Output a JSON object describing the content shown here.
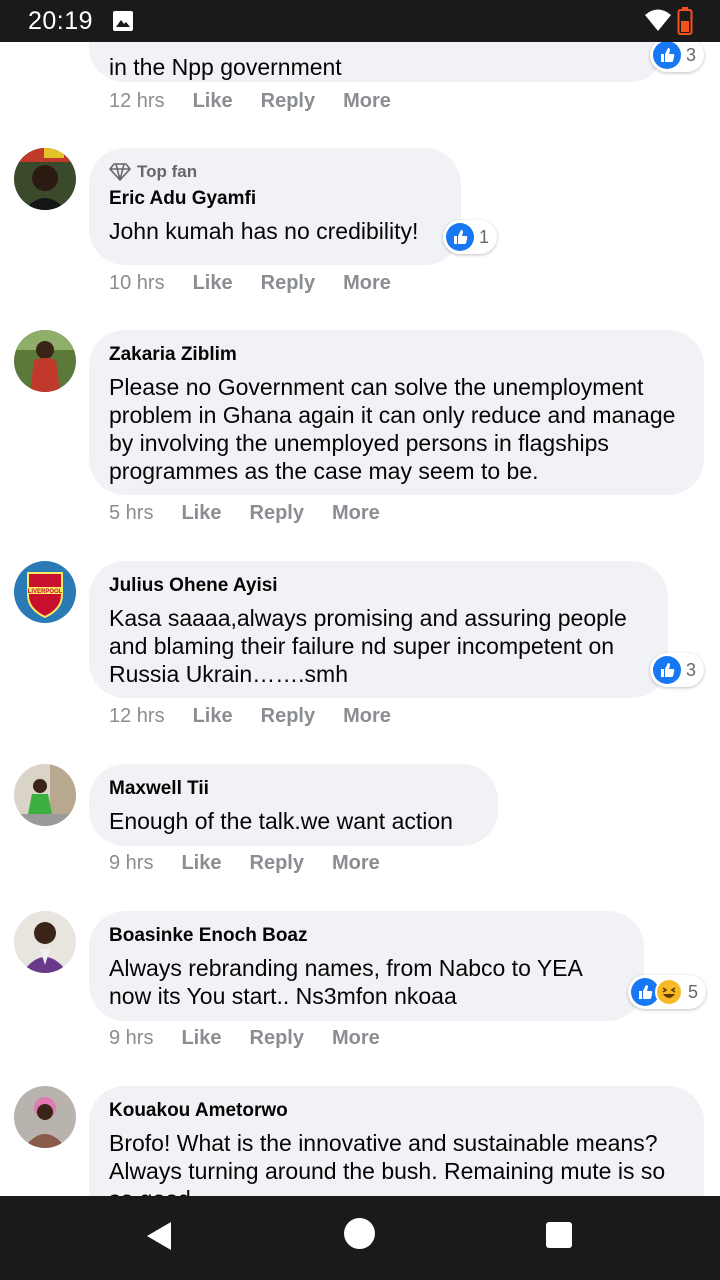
{
  "status_bar": {
    "time": "20:19"
  },
  "comments": [
    {
      "author": "",
      "text": "in the Npp government",
      "time": "12 hrs",
      "like": "Like",
      "reply": "Reply",
      "more": "More",
      "reaction_count": "3"
    },
    {
      "top_fan_label": "Top fan",
      "author": "Eric Adu Gyamfi",
      "text": "John kumah has no credibility!",
      "time": "10 hrs",
      "like": "Like",
      "reply": "Reply",
      "more": "More",
      "reaction_count": "1"
    },
    {
      "author": "Zakaria Ziblim",
      "text": "Please no Government can solve the unemployment problem in Ghana again it can only reduce and manage by involving the unemployed persons in flagships programmes as the case may seem to be.",
      "time": "5 hrs",
      "like": "Like",
      "reply": "Reply",
      "more": "More"
    },
    {
      "author": "Julius Ohene Ayisi",
      "text": "Kasa saaaa,always promising and assuring people and blaming their failure nd super incompetent on Russia Ukrain…….smh",
      "time": "12 hrs",
      "like": "Like",
      "reply": "Reply",
      "more": "More",
      "reaction_count": "3"
    },
    {
      "author": "Maxwell Tii",
      "text": "Enough of the talk.we want action",
      "time": "9 hrs",
      "like": "Like",
      "reply": "Reply",
      "more": "More"
    },
    {
      "author": "Boasinke Enoch Boaz",
      "text": "Always rebranding names, from Nabco to YEA now its You start.. Ns3mfon nkoaa",
      "time": "9 hrs",
      "like": "Like",
      "reply": "Reply",
      "more": "More",
      "reaction_count": "5"
    },
    {
      "author": "Kouakou Ametorwo",
      "text": "Brofo! What is the innovative and sustainable means? Always turning around the bush. Remaining mute is so so good"
    }
  ],
  "colors": {
    "like_blue": "#1877f2",
    "bubble": "#f0f2f5",
    "meta": "#8a8d91",
    "bars": "#1a1a1a"
  },
  "icons": [
    "gallery-icon",
    "wifi-icon",
    "battery-icon",
    "like-reaction-icon",
    "haha-reaction-icon",
    "diamond-icon",
    "back-icon",
    "home-icon",
    "recents-icon"
  ]
}
